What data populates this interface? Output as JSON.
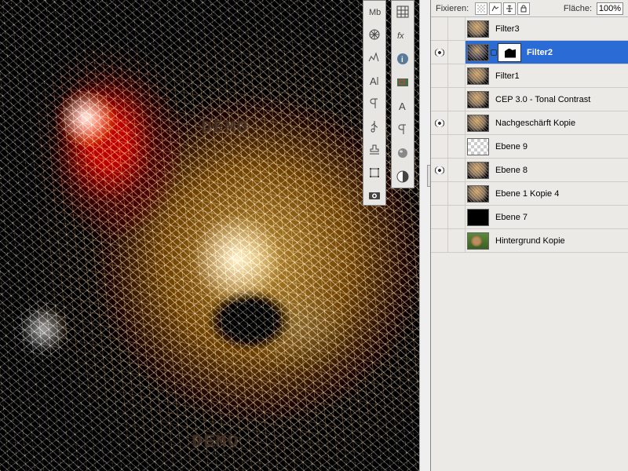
{
  "canvas": {
    "watermark_text": "DEMO"
  },
  "toolbar1": {
    "icons": [
      "character-icon",
      "grid-icon",
      "wheel-icon",
      "nav-icon",
      "histogram-icon",
      "swatch-icon",
      "crop-tool-icon",
      "stamp-icon",
      "transform-icon",
      "camera-icon"
    ]
  },
  "toolbar2": {
    "icons": [
      "fx-icon",
      "info-icon",
      "type-icon",
      "paragraph-icon",
      "usb-icon",
      "sphere-icon",
      "bw-icon"
    ]
  },
  "panel": {
    "lock_label": "Fixieren:",
    "fill_label": "Fläche:",
    "fill_value": "100%"
  },
  "layers": [
    {
      "name": "Filter3",
      "visible": false,
      "selected": false,
      "thumb": "cat",
      "mask": false
    },
    {
      "name": "Filter2",
      "visible": true,
      "selected": true,
      "thumb": "cat",
      "mask": true
    },
    {
      "name": "Filter1",
      "visible": false,
      "selected": false,
      "thumb": "cat",
      "mask": false
    },
    {
      "name": "CEP 3.0 - Tonal Contrast",
      "visible": false,
      "selected": false,
      "thumb": "cat",
      "mask": false
    },
    {
      "name": "Nachgeschärft Kopie",
      "visible": true,
      "selected": false,
      "thumb": "cat",
      "mask": false
    },
    {
      "name": "Ebene 9",
      "visible": false,
      "selected": false,
      "thumb": "trans",
      "mask": false
    },
    {
      "name": "Ebene 8",
      "visible": true,
      "selected": false,
      "thumb": "cat",
      "mask": false
    },
    {
      "name": "Ebene 1 Kopie 4",
      "visible": false,
      "selected": false,
      "thumb": "cat",
      "mask": false
    },
    {
      "name": "Ebene 7",
      "visible": false,
      "selected": false,
      "thumb": "black",
      "mask": false
    },
    {
      "name": "Hintergrund Kopie",
      "visible": false,
      "selected": false,
      "thumb": "green",
      "mask": false
    }
  ]
}
